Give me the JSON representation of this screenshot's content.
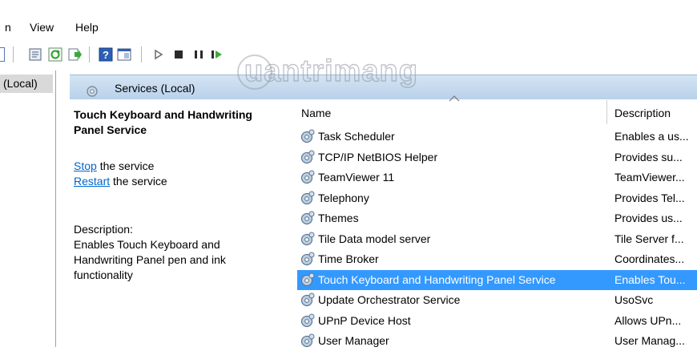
{
  "menu": {
    "items": [
      "n",
      "View",
      "Help"
    ]
  },
  "toolbar": {
    "buttons": [
      "console-icon",
      "properties-icon",
      "refresh-icon",
      "export-icon",
      "help-icon",
      "view-icon",
      "play-icon",
      "stop-icon",
      "pause-icon",
      "resume-icon"
    ]
  },
  "tree": {
    "selected_label": "(Local)"
  },
  "header": {
    "title": "Services (Local)",
    "icon": "services-gear-icon"
  },
  "watermark": {
    "text": "uantrimang"
  },
  "detail": {
    "service_title_line1": "Touch Keyboard and Handwriting",
    "service_title_line2": "Panel Service",
    "stop_link": "Stop",
    "stop_suffix": " the service",
    "restart_link": "Restart",
    "restart_suffix": " the service",
    "description_label": "Description:",
    "description_line1": "Enables Touch Keyboard and",
    "description_line2": "Handwriting Panel pen and ink",
    "description_line3": "functionality"
  },
  "columns": {
    "name": "Name",
    "description": "Description"
  },
  "services": [
    {
      "name": "Task Scheduler",
      "description": "Enables a us...",
      "selected": false
    },
    {
      "name": "TCP/IP NetBIOS Helper",
      "description": "Provides su...",
      "selected": false
    },
    {
      "name": "TeamViewer 11",
      "description": "TeamViewer...",
      "selected": false
    },
    {
      "name": "Telephony",
      "description": "Provides Tel...",
      "selected": false
    },
    {
      "name": "Themes",
      "description": "Provides us...",
      "selected": false
    },
    {
      "name": "Tile Data model server",
      "description": "Tile Server f...",
      "selected": false
    },
    {
      "name": "Time Broker",
      "description": "Coordinates...",
      "selected": false
    },
    {
      "name": "Touch Keyboard and Handwriting Panel Service",
      "description": "Enables Tou...",
      "selected": true
    },
    {
      "name": "Update Orchestrator Service",
      "description": "UsoSvc",
      "selected": false
    },
    {
      "name": "UPnP Device Host",
      "description": "Allows UPn...",
      "selected": false
    },
    {
      "name": "User Manager",
      "description": "User Manag...",
      "selected": false
    }
  ],
  "colors": {
    "selection": "#3399ff",
    "link": "#0066cc",
    "header_band": "#c6dbef"
  }
}
